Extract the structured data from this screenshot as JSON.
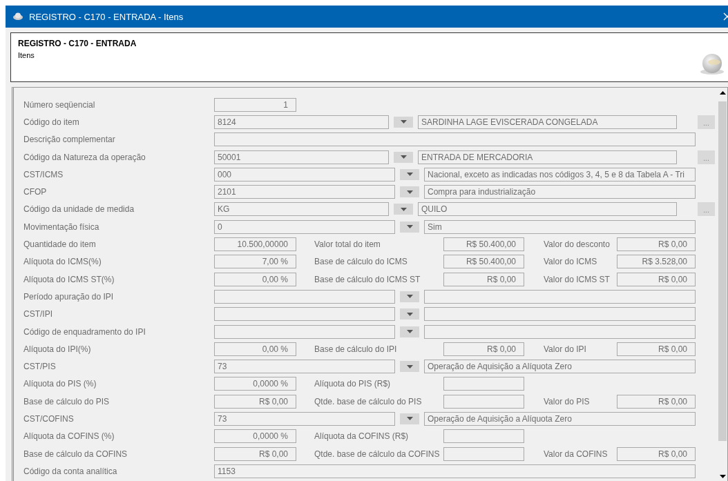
{
  "window": {
    "title": "REGISTRO - C170 - ENTRADA - Itens"
  },
  "header": {
    "title": "REGISTRO - C170 - ENTRADA",
    "subtitle": "Itens"
  },
  "rows": [
    {
      "kind": "short",
      "label": "Número seqüencial",
      "value": "1"
    },
    {
      "kind": "combo",
      "label": "Código do item",
      "code": "8124",
      "description": "SARDINHA LAGE EVISCERADA CONGELADA",
      "lookup": "..."
    },
    {
      "kind": "full",
      "label": "Descrição complementar"
    },
    {
      "kind": "combo",
      "label": "Código da Natureza da operação",
      "code": "50001",
      "description": "ENTRADA DE MERCADORIA",
      "lookup": "..."
    },
    {
      "kind": "combo",
      "label": "CST/ICMS",
      "code": "000",
      "description": "Nacional, exceto as indicadas nos códigos 3, 4, 5 e 8 da Tabela A - Tri"
    },
    {
      "kind": "combo",
      "label": "CFOP",
      "code": "2101",
      "description": "Compra para industrialização"
    },
    {
      "kind": "combo",
      "label": "Código da unidade de medida",
      "code": "KG",
      "description": "QUILO",
      "lookup": "..."
    },
    {
      "kind": "combo",
      "label": "Movimentação física",
      "code": "0",
      "description": "Sim"
    },
    {
      "kind": "triple",
      "label": "Quantidade do item",
      "value": "10.500,00000",
      "fields": [
        {
          "label": "Valor total do item",
          "value": "R$ 50.400,00"
        },
        {
          "label": "Valor do desconto",
          "value": "R$ 0,00"
        }
      ]
    },
    {
      "kind": "triple",
      "label": "Alíquota do ICMS(%)",
      "value": "7,00 %",
      "fields": [
        {
          "label": "Base de cálculo do ICMS",
          "value": "R$ 50.400,00"
        },
        {
          "label": "Valor do ICMS",
          "value": "R$ 3.528,00"
        }
      ]
    },
    {
      "kind": "triple",
      "label": "Alíquota do ICMS ST(%)",
      "value": "0,00 %",
      "fields": [
        {
          "label": "Base de cálculo do ICMS ST",
          "value": "R$ 0,00"
        },
        {
          "label": "Valor do ICMS ST",
          "value": "R$ 0,00"
        }
      ]
    },
    {
      "kind": "combo",
      "label": "Período apuração do IPI"
    },
    {
      "kind": "combo",
      "label": "CST/IPI"
    },
    {
      "kind": "combo",
      "label": "Código de enquadramento do IPI"
    },
    {
      "kind": "triple",
      "label": "Alíquota do IPI(%)",
      "value": "0,00 %",
      "fields": [
        {
          "label": "Base de cálculo do IPI",
          "value": "R$ 0,00"
        },
        {
          "label": "Valor do IPI",
          "value": "R$ 0,00"
        }
      ]
    },
    {
      "kind": "combo",
      "label": "CST/PIS",
      "code": "73",
      "description": "Operação de Aquisição a Alíquota Zero"
    },
    {
      "kind": "triple",
      "label": "Alíquota do PIS (%)",
      "value": "0,0000 %",
      "fields": [
        {
          "label": "Alíquota do PIS (R$)"
        }
      ]
    },
    {
      "kind": "triple",
      "label": "Base de cálculo do PIS",
      "value": "R$ 0,00",
      "fields": [
        {
          "label": "Qtde. base de cálculo do PIS"
        },
        {
          "label": "Valor do PIS",
          "value": "R$ 0,00"
        }
      ]
    },
    {
      "kind": "combo",
      "label": "CST/COFINS",
      "code": "73",
      "description": "Operação de Aquisição a Alíquota Zero"
    },
    {
      "kind": "triple",
      "label": "Alíquota da COFINS (%)",
      "value": "0,0000 %",
      "fields": [
        {
          "label": "Alíquota da COFINS (R$)"
        }
      ]
    },
    {
      "kind": "triple",
      "label": "Base de cálculo da COFINS",
      "value": "R$ 0,00",
      "fields": [
        {
          "label": "Qtde. base de cálculo da COFINS"
        },
        {
          "label": "Valor da COFINS",
          "value": "R$ 0,00"
        }
      ]
    },
    {
      "kind": "full",
      "label": "Código da conta analítica",
      "value": "1153"
    }
  ]
}
